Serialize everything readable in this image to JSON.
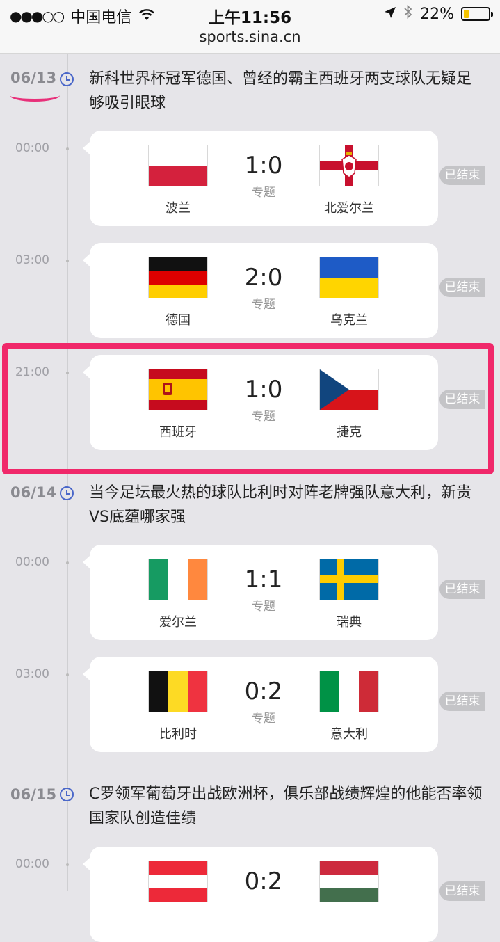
{
  "status_bar": {
    "carrier": "中国电信",
    "time": "上午11:56",
    "battery_percent": "22%",
    "battery_level": 0.22,
    "signal_dots": "●●●○○"
  },
  "url_bar": {
    "host": "sports.sina.cn"
  },
  "days": [
    {
      "date": "06/13",
      "headline": "新科世界杯冠军德国、曾经的霸主西班牙两支球队无疑足够吸引眼球",
      "matches": [
        {
          "time": "00:00",
          "home": "波兰",
          "away": "北爱尔兰",
          "score": "1:0",
          "topic": "专题",
          "status": "已结束",
          "home_flag": "poland-flag",
          "away_flag": "northern-ireland-flag"
        },
        {
          "time": "03:00",
          "home": "德国",
          "away": "乌克兰",
          "score": "2:0",
          "topic": "专题",
          "status": "已结束",
          "home_flag": "germany-flag",
          "away_flag": "ukraine-flag"
        },
        {
          "time": "21:00",
          "home": "西班牙",
          "away": "捷克",
          "score": "1:0",
          "topic": "专题",
          "status": "已结束",
          "home_flag": "spain-flag",
          "away_flag": "czech-flag"
        }
      ]
    },
    {
      "date": "06/14",
      "headline": "当今足坛最火热的球队比利时对阵老牌强队意大利，新贵VS底蕴哪家强",
      "matches": [
        {
          "time": "00:00",
          "home": "爱尔兰",
          "away": "瑞典",
          "score": "1:1",
          "topic": "专题",
          "status": "已结束",
          "home_flag": "ireland-flag",
          "away_flag": "sweden-flag"
        },
        {
          "time": "03:00",
          "home": "比利时",
          "away": "意大利",
          "score": "0:2",
          "topic": "专题",
          "status": "已结束",
          "home_flag": "belgium-flag",
          "away_flag": "italy-flag"
        }
      ]
    },
    {
      "date": "06/15",
      "headline": "C罗领军葡萄牙出战欧洲杯，俱乐部战绩辉煌的他能否率领国家队创造佳绩",
      "matches": [
        {
          "time": "00:00",
          "score": "0:2",
          "status": "已结束",
          "home_flag": "austria-flag",
          "away_flag": "hungary-flag"
        }
      ]
    }
  ],
  "colors": {
    "accent": "#4a67c9",
    "highlight": "#f0286a",
    "status_pill": "#c4c4c7",
    "background": "#e6e5e9"
  }
}
